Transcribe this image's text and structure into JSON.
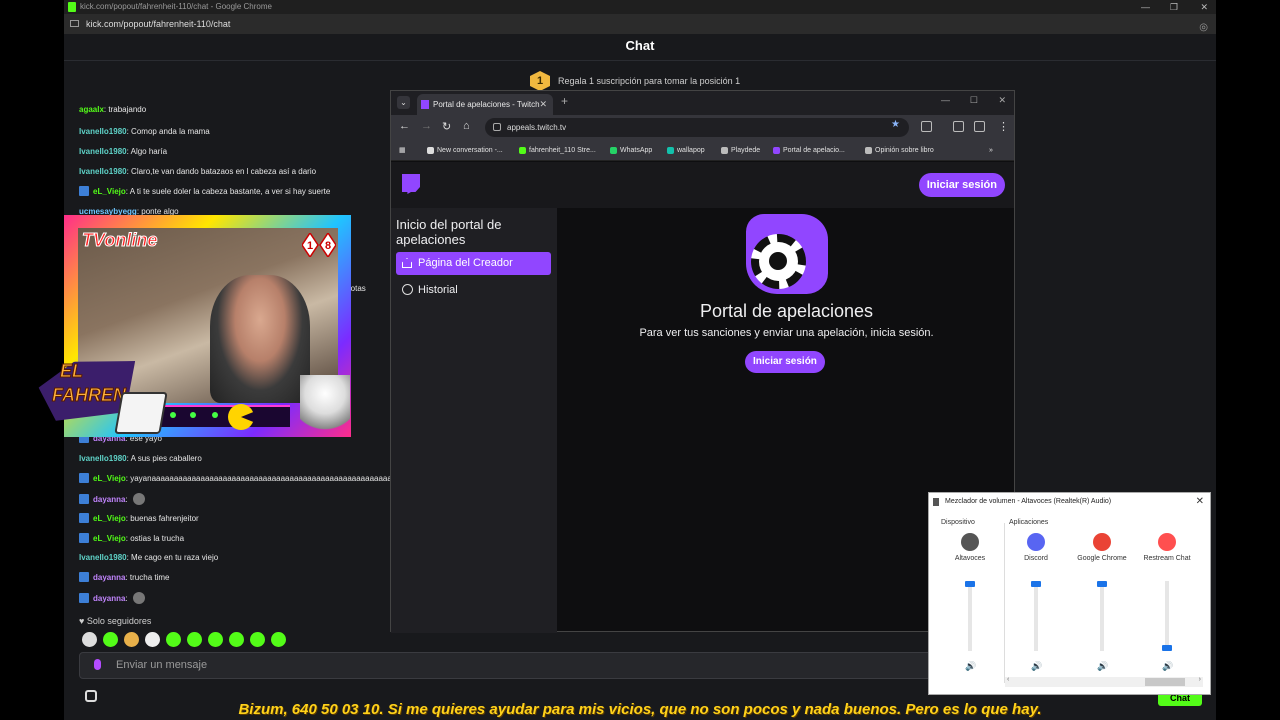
{
  "browser": {
    "window_title": "kick.com/popout/fahrenheit-110/chat - Google Chrome",
    "url": "kick.com/popout/fahrenheit-110/chat"
  },
  "chat": {
    "title": "Chat",
    "gift_badge": "1",
    "gift_text": "Regala 1 suscripción para tomar la posición 1",
    "messages_top": [
      {
        "user": "agaalx",
        "text": "trabajando",
        "color": "#53fc18",
        "badge": false
      },
      {
        "user": "Ivanello1980",
        "text": "Comop anda la mama",
        "color": "#5fd3c8",
        "badge": false
      },
      {
        "user": "Ivanello1980",
        "text": "Algo haría",
        "color": "#5fd3c8",
        "badge": false
      },
      {
        "user": "Ivanello1980",
        "text": "Claro,te van dando batazaos en l cabeza así a dario",
        "color": "#5fd3c8",
        "badge": false
      },
      {
        "user": "eL_Viejo",
        "text": "A ti te suele doler la cabeza bastante, a ver si hay suerte",
        "color": "#53fc18",
        "badge": true
      },
      {
        "user": "ucmesaybyegg",
        "text": "ponte algo",
        "color": "#6ec6ff",
        "badge": false
      }
    ],
    "partial_word": "pelotas",
    "messages_bottom": [
      {
        "user": "dayanna",
        "text": "ese yayo",
        "color": "#c084fc",
        "badge": true,
        "emote": false
      },
      {
        "user": "Ivanello1980",
        "text": "A sus pies caballero",
        "color": "#5fd3c8",
        "badge": false,
        "emote": false
      },
      {
        "user": "eL_Viejo",
        "text": "yayanaaaaaaaaaaaaaaaaaaaaaaaaaaaaaaaaaaaaaaaaaaaaaaaaaaaaaaaaaa",
        "color": "#53fc18",
        "badge": true,
        "emote": false
      },
      {
        "user": "dayanna",
        "text": "",
        "color": "#c084fc",
        "badge": true,
        "emote": true
      },
      {
        "user": "eL_Viejo",
        "text": "buenas fahrenjeitor",
        "color": "#53fc18",
        "badge": true,
        "emote": false
      },
      {
        "user": "eL_Viejo",
        "text": "ostias la trucha",
        "color": "#53fc18",
        "badge": true,
        "emote": false
      },
      {
        "user": "Ivanello1980",
        "text": "Me cago en tu raza viejo",
        "color": "#5fd3c8",
        "badge": false,
        "emote": false
      },
      {
        "user": "dayanna",
        "text": "trucha time",
        "color": "#c084fc",
        "badge": true,
        "emote": false
      },
      {
        "user": "dayanna",
        "text": "",
        "color": "#c084fc",
        "badge": true,
        "emote": true
      }
    ],
    "followers_only": "Solo seguidores",
    "emote_colors": [
      "#ddd",
      "#53fc18",
      "#e8b04a",
      "#eee",
      "#53fc18",
      "#53fc18",
      "#53fc18",
      "#53fc18",
      "#53fc18",
      "#53fc18"
    ],
    "input_placeholder": "Enviar un mensaje",
    "chat_button": "Chat"
  },
  "overlay": {
    "tv_online": "TVonline",
    "dice": "18",
    "logo_line1": "EL",
    "logo_line2": "FAHREN",
    "ticker": "Bizum, 640 50 03 10.  Si me quieres ayudar para mis vicios, que no son pocos y nada buenos. Pero es lo que hay."
  },
  "twitch_window": {
    "tab_title": "Portal de apelaciones - Twitch",
    "address": "appeals.twitch.tv",
    "bookmarks": [
      {
        "label": "New conversation -...",
        "color": "#ddd"
      },
      {
        "label": "fahrenheit_110 Stre...",
        "color": "#53fc18"
      },
      {
        "label": "WhatsApp",
        "color": "#25d366"
      },
      {
        "label": "wallapop",
        "color": "#13c1ac"
      },
      {
        "label": "Playdede",
        "color": "#bbb"
      },
      {
        "label": "Portal de apelacio...",
        "color": "#9146ff"
      },
      {
        "label": "Opinión sobre libro",
        "color": "#bbb"
      }
    ],
    "login_button": "Iniciar sesión",
    "sidebar_title": "Inicio del portal de apelaciones",
    "sidebar_creator": "Página del Creador",
    "sidebar_history": "Historial",
    "main_title": "Portal de apelaciones",
    "main_subtitle": "Para ver tus sanciones y enviar una apelación, inicia sesión.",
    "main_login": "Iniciar sesión",
    "accent": "#9146ff"
  },
  "volume_mixer": {
    "title": "Mezclador de volumen - Altavoces (Realtek(R) Audio)",
    "device_label": "Dispositivo",
    "apps_label": "Aplicaciones",
    "channels": [
      {
        "name": "Altavoces",
        "level": 1.0,
        "color": "#555"
      },
      {
        "name": "Discord",
        "level": 1.0,
        "color": "#5865f2"
      },
      {
        "name": "Google Chrome",
        "level": 1.0,
        "color": "#ea4335"
      },
      {
        "name": "Restream Chat",
        "level": 0.0,
        "color": "#ff4f4f"
      }
    ]
  }
}
